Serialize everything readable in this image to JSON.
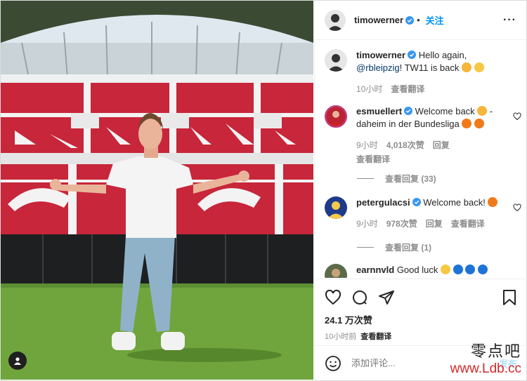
{
  "header": {
    "username": "timowerner",
    "dot": "•",
    "follow_label": "关注",
    "more_label": "···"
  },
  "caption": {
    "username": "timowerner",
    "text_1": "Hello again,",
    "mention": "@rbleipzig",
    "text_2": "! TW11 is back",
    "time": "10小时",
    "translate": "查看翻译"
  },
  "comments": [
    {
      "username": "esmuellert",
      "text": "Welcome back",
      "text_2": " - daheim in der Bundesliga",
      "time": "9小时",
      "likes": "4,018次赞",
      "reply": "回复",
      "translate": "查看翻译",
      "replies": "查看回复 (33)"
    },
    {
      "username": "petergulacsi",
      "text": "Welcome back!",
      "time": "9小时",
      "likes": "978次赞",
      "reply": "回复",
      "translate": "查看翻译",
      "replies": "查看回复 (1)"
    },
    {
      "username": "earnnvld",
      "text": "Good luck"
    }
  ],
  "footer": {
    "likes": "24.1 万次赞",
    "time": "10小时前",
    "translate": "查看翻译",
    "comment_placeholder": "添加评论...",
    "post_label": "发布"
  },
  "watermark": {
    "text_cn": "零点吧",
    "url": "www.Ldb.cc"
  },
  "colors": {
    "accent": "#0095f6",
    "verified": "#3897f0",
    "link": "#00376b",
    "muted": "#8e8e8e",
    "grass": "#6fa53c",
    "seats_red": "#c8263a"
  }
}
